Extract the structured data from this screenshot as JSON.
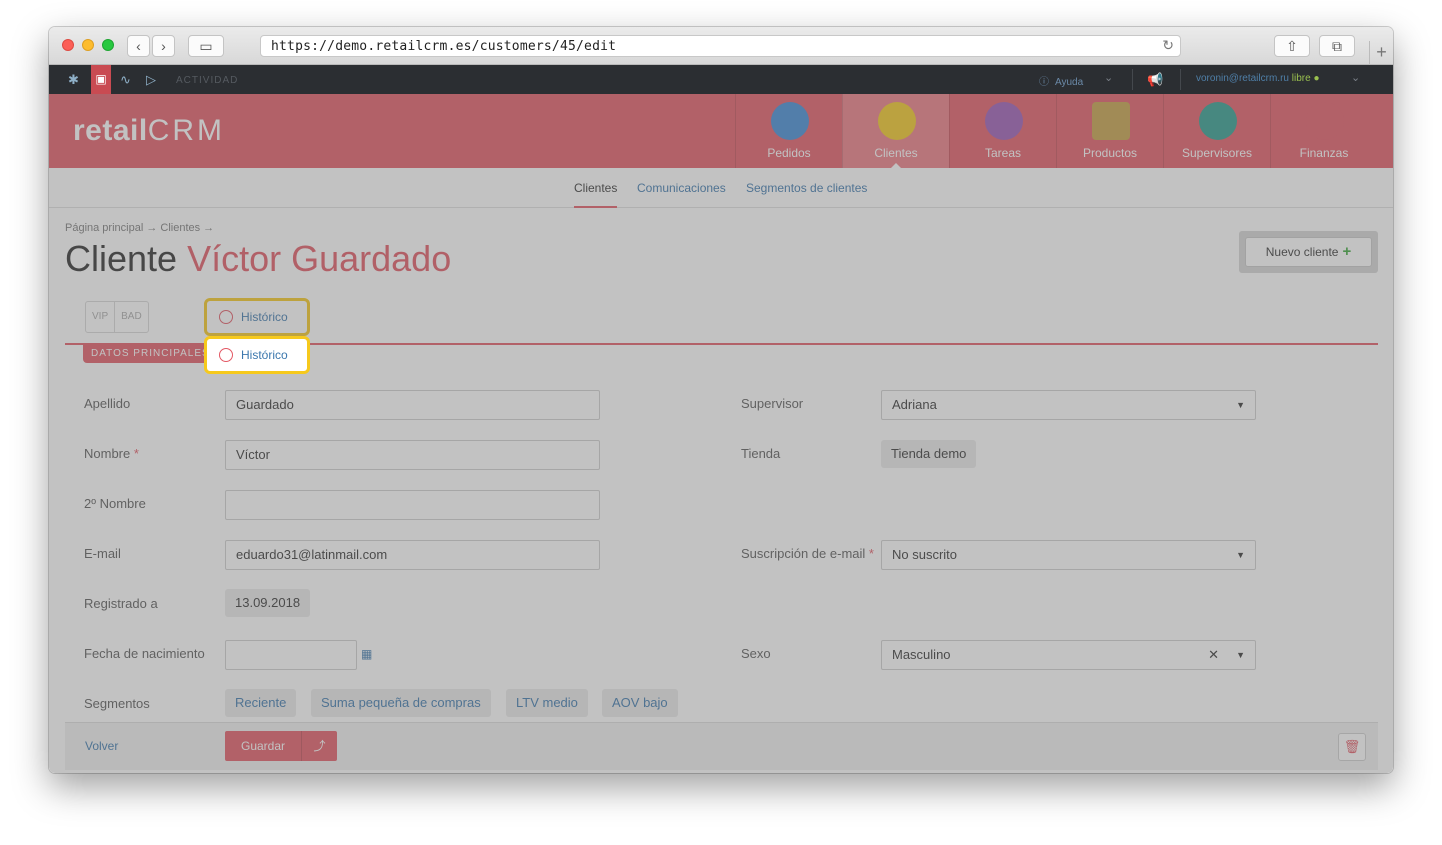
{
  "browser": {
    "url": "https://demo.retailcrm.es/customers/45/edit"
  },
  "topbar": {
    "activity": "ACTIVIDAD",
    "help": "Ayuda",
    "user_email": "voronin@retailcrm.ru",
    "user_status": "libre"
  },
  "header": {
    "logo_main": "retail",
    "logo_crm": "CRM",
    "nav": [
      {
        "label": "Pedidos",
        "icon": "cart-icon",
        "color": "#3e8ad6"
      },
      {
        "label": "Clientes",
        "icon": "person-icon",
        "color": "#f3c81f"
      },
      {
        "label": "Tareas",
        "icon": "list-icon",
        "color": "#9b59b6"
      },
      {
        "label": "Productos",
        "icon": "box-icon",
        "color": "#c7a046"
      },
      {
        "label": "Supervisores",
        "icon": "woman-icon",
        "color": "#2c9c8d"
      },
      {
        "label": "Finanzas",
        "icon": "ledger-icon",
        "color": "#e35864"
      }
    ]
  },
  "subnav": {
    "items": [
      "Clientes",
      "Comunicaciones",
      "Segmentos de clientes"
    ]
  },
  "page": {
    "breadcrumb": "Página principal → Clientes →",
    "title_prefix": "Cliente",
    "title_name": "Víctor Guardado",
    "new_client": "Nuevo cliente"
  },
  "card": {
    "tags": [
      "VIP",
      "BAD"
    ],
    "history": "Histórico",
    "section": "DATOS PRINCIPALES"
  },
  "form": {
    "apellido_label": "Apellido",
    "apellido_value": "Guardado",
    "nombre_label": "Nombre",
    "nombre_value": "Víctor",
    "nombre2_label": "2º Nombre",
    "nombre2_value": "",
    "email_label": "E-mail",
    "email_value": "eduardo31@latinmail.com",
    "registrado_label": "Registrado a",
    "registrado_value": "13.09.2018",
    "nacimiento_label": "Fecha de nacimiento",
    "nacimiento_value": "",
    "segmentos_label": "Segmentos",
    "segmentos": [
      "Reciente",
      "Suma pequeña de compras",
      "LTV medio",
      "AOV bajo"
    ],
    "supervisor_label": "Supervisor",
    "supervisor_value": "Adriana",
    "tienda_label": "Tienda",
    "tienda_value": "Tienda demo",
    "suscripcion_label": "Suscripción de e-mail",
    "suscripcion_value": "No suscrito",
    "sexo_label": "Sexo",
    "sexo_value": "Masculino",
    "required_mark": "*"
  },
  "footer": {
    "back": "Volver",
    "save": "Guardar"
  },
  "colors": {
    "brand_red": "#e35864",
    "link_blue": "#3b77ad",
    "highlight_yellow": "#f6c91c"
  }
}
